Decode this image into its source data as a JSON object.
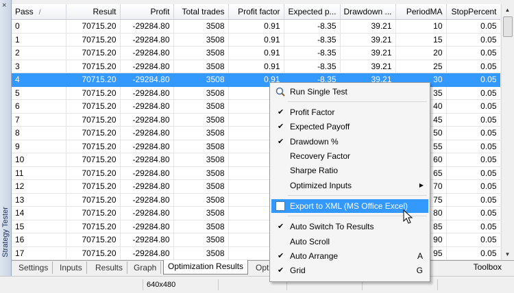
{
  "panel": {
    "title": "Strategy Tester",
    "close_glyph": "×"
  },
  "table": {
    "columns": [
      "Pass",
      "Result",
      "Profit",
      "Total trades",
      "Profit factor",
      "Expected p...",
      "Drawdown ...",
      "PeriodMA",
      "StopPercent"
    ],
    "sort_indicator": "/",
    "selected_index": 4,
    "rows": [
      [
        "0",
        "70715.20",
        "-29284.80",
        "3508",
        "0.91",
        "-8.35",
        "39.21",
        "10",
        "0.05"
      ],
      [
        "1",
        "70715.20",
        "-29284.80",
        "3508",
        "0.91",
        "-8.35",
        "39.21",
        "15",
        "0.05"
      ],
      [
        "2",
        "70715.20",
        "-29284.80",
        "3508",
        "0.91",
        "-8.35",
        "39.21",
        "20",
        "0.05"
      ],
      [
        "3",
        "70715.20",
        "-29284.80",
        "3508",
        "0.91",
        "-8.35",
        "39.21",
        "25",
        "0.05"
      ],
      [
        "4",
        "70715.20",
        "-29284.80",
        "3508",
        "0.91",
        "-8.35",
        "39.21",
        "30",
        "0.05"
      ],
      [
        "5",
        "70715.20",
        "-29284.80",
        "3508",
        "",
        "",
        "",
        "35",
        "0.05"
      ],
      [
        "6",
        "70715.20",
        "-29284.80",
        "3508",
        "",
        "",
        "",
        "40",
        "0.05"
      ],
      [
        "7",
        "70715.20",
        "-29284.80",
        "3508",
        "",
        "",
        "",
        "45",
        "0.05"
      ],
      [
        "8",
        "70715.20",
        "-29284.80",
        "3508",
        "",
        "",
        "",
        "50",
        "0.05"
      ],
      [
        "9",
        "70715.20",
        "-29284.80",
        "3508",
        "",
        "",
        "",
        "55",
        "0.05"
      ],
      [
        "10",
        "70715.20",
        "-29284.80",
        "3508",
        "",
        "",
        "",
        "60",
        "0.05"
      ],
      [
        "11",
        "70715.20",
        "-29284.80",
        "3508",
        "",
        "",
        "",
        "65",
        "0.05"
      ],
      [
        "12",
        "70715.20",
        "-29284.80",
        "3508",
        "",
        "",
        "",
        "70",
        "0.05"
      ],
      [
        "13",
        "70715.20",
        "-29284.80",
        "3508",
        "",
        "",
        "",
        "75",
        "0.05"
      ],
      [
        "14",
        "70715.20",
        "-29284.80",
        "3508",
        "",
        "",
        "",
        "80",
        "0.05"
      ],
      [
        "15",
        "70715.20",
        "-29284.80",
        "3508",
        "",
        "",
        "",
        "85",
        "0.05"
      ],
      [
        "16",
        "70715.20",
        "-29284.80",
        "3508",
        "",
        "",
        "",
        "90",
        "0.05"
      ],
      [
        "17",
        "70715.20",
        "-29284.80",
        "3508",
        "",
        "",
        "",
        "95",
        "0.05"
      ]
    ]
  },
  "tabs": [
    {
      "label": "Settings",
      "active": false
    },
    {
      "label": "Inputs",
      "active": false
    },
    {
      "label": "Results",
      "active": false
    },
    {
      "label": "Graph",
      "active": false
    },
    {
      "label": "Optimization Results",
      "active": true
    },
    {
      "label": "Opt",
      "active": false
    }
  ],
  "toolbox": "Toolbox",
  "status": {
    "resolution": "640x480"
  },
  "context_menu": {
    "run": "Run Single Test",
    "profit_factor": "Profit Factor",
    "expected_payoff": "Expected Payoff",
    "drawdown": "Drawdown %",
    "recovery_factor": "Recovery Factor",
    "sharpe_ratio": "Sharpe Ratio",
    "optimized_inputs": "Optimized Inputs",
    "export_xml": "Export to XML (MS Office Excel)",
    "auto_switch": "Auto Switch To Results",
    "auto_scroll": "Auto Scroll",
    "auto_arrange": "Auto Arrange",
    "auto_arrange_key": "A",
    "grid": "Grid",
    "grid_key": "G",
    "checked": [
      "profit_factor",
      "expected_payoff",
      "drawdown",
      "auto_switch",
      "auto_arrange",
      "grid"
    ]
  },
  "colors": {
    "selection": "#3399ff"
  }
}
